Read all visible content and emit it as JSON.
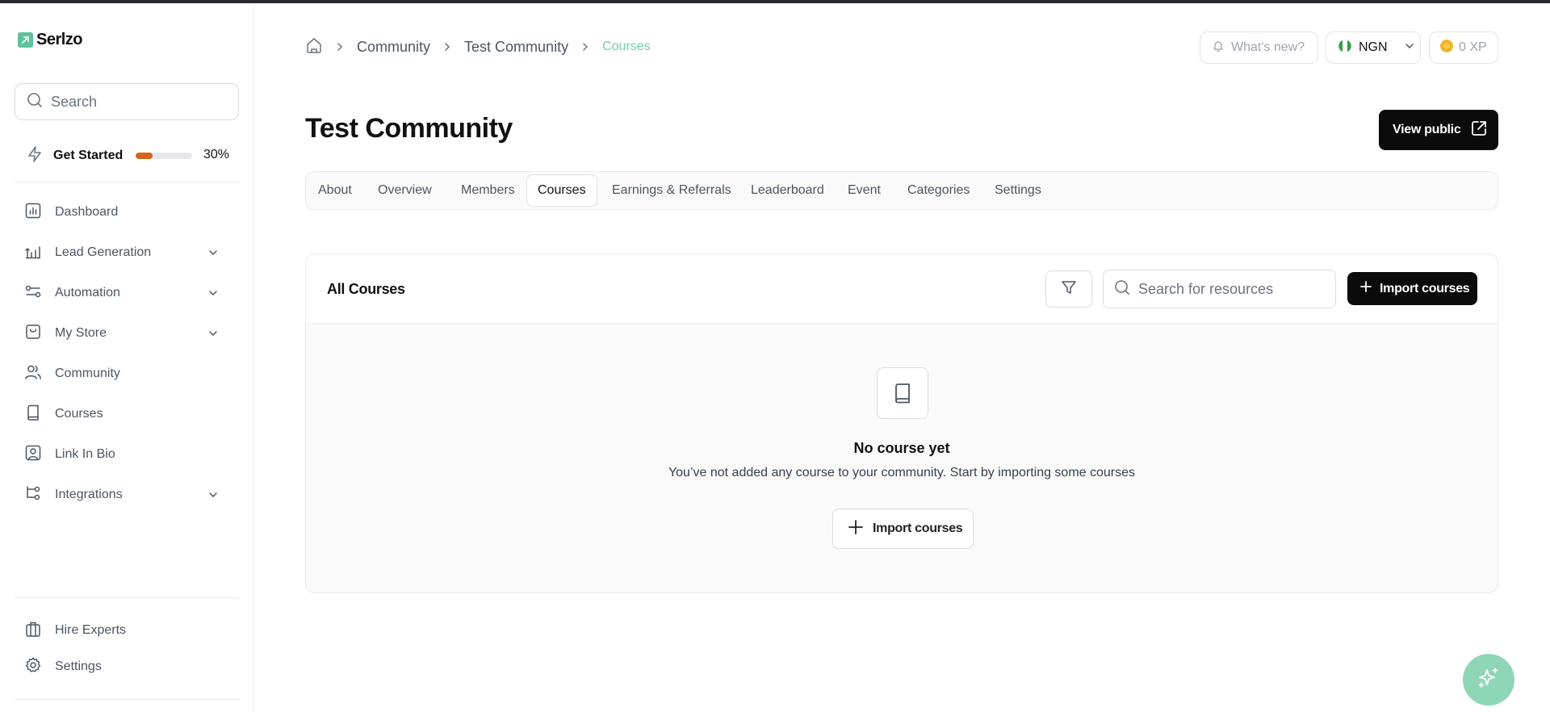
{
  "brand": {
    "name": "Serlzo",
    "accent": "#5ec29b"
  },
  "sidebar": {
    "search_placeholder": "Search",
    "get_started": {
      "label": "Get Started",
      "progress_percent": 30,
      "progress_text": "30%"
    },
    "items": [
      {
        "label": "Dashboard",
        "icon": "chart-icon",
        "expandable": false
      },
      {
        "label": "Lead Generation",
        "icon": "lead-generation-icon",
        "expandable": true
      },
      {
        "label": "Automation",
        "icon": "automation-icon",
        "expandable": true
      },
      {
        "label": "My Store",
        "icon": "store-icon",
        "expandable": true
      },
      {
        "label": "Community",
        "icon": "users-icon",
        "expandable": false
      },
      {
        "label": "Courses",
        "icon": "book-icon",
        "expandable": false
      },
      {
        "label": "Link In Bio",
        "icon": "link-in-bio-icon",
        "expandable": false
      },
      {
        "label": "Integrations",
        "icon": "integrations-icon",
        "expandable": true
      }
    ],
    "bottom_items": [
      {
        "label": "Hire Experts",
        "icon": "briefcase-icon"
      },
      {
        "label": "Settings",
        "icon": "gear-icon"
      }
    ]
  },
  "header": {
    "breadcrumb": [
      "Community",
      "Test Community",
      "Courses"
    ],
    "whats_new": "What's new?",
    "currency": "NGN",
    "xp": "0 XP"
  },
  "page": {
    "title": "Test Community",
    "view_public": "View public",
    "tabs": [
      "About",
      "Overview",
      "Members",
      "Courses",
      "Earnings & Referrals",
      "Leaderboard",
      "Event",
      "Categories",
      "Settings"
    ],
    "active_tab": "Courses"
  },
  "courses_card": {
    "title": "All Courses",
    "search_placeholder": "Search for resources",
    "import_label": "Import courses",
    "empty_title": "No course yet",
    "empty_text": "You’ve not added any course to your community. Start by importing some courses",
    "empty_import_label": "Import courses"
  }
}
